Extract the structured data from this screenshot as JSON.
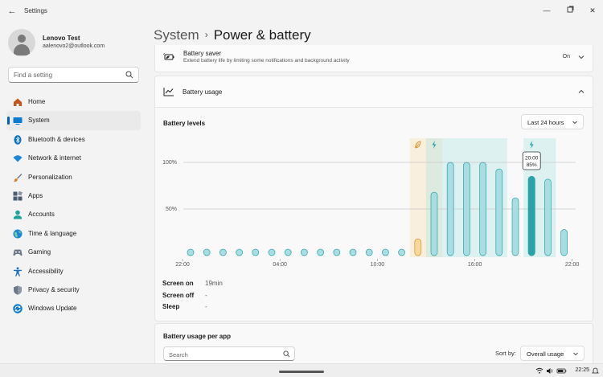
{
  "window": {
    "title": "Settings"
  },
  "profile": {
    "name": "Lenovo Test",
    "email": "aalenovo2@outlook.com"
  },
  "sidebar": {
    "search_placeholder": "Find a setting",
    "items": [
      {
        "label": "Home",
        "icon": "home-icon",
        "color": "#c7551e"
      },
      {
        "label": "System",
        "icon": "system-icon",
        "color": "#0a7bd0",
        "active": true
      },
      {
        "label": "Bluetooth & devices",
        "icon": "bluetooth-icon",
        "color": "#0a6fc7"
      },
      {
        "label": "Network & internet",
        "icon": "wifi-icon",
        "color": "#1b88d6"
      },
      {
        "label": "Personalization",
        "icon": "brush-icon",
        "color": "#d9822b"
      },
      {
        "label": "Apps",
        "icon": "apps-icon",
        "color": "#4b5b72"
      },
      {
        "label": "Accounts",
        "icon": "accounts-icon",
        "color": "#1aa39a"
      },
      {
        "label": "Time & language",
        "icon": "globe-icon",
        "color": "#1b88d6"
      },
      {
        "label": "Gaming",
        "icon": "gaming-icon",
        "color": "#6c7788"
      },
      {
        "label": "Accessibility",
        "icon": "accessibility-icon",
        "color": "#1b6fc2"
      },
      {
        "label": "Privacy & security",
        "icon": "shield-icon",
        "color": "#6c7788"
      },
      {
        "label": "Windows Update",
        "icon": "update-icon",
        "color": "#0a7bd0"
      }
    ]
  },
  "header": {
    "crumb_parent": "System",
    "crumb_separator": "›",
    "title": "Power & battery"
  },
  "battery_saver": {
    "title": "Battery saver",
    "description": "Extend battery life by limiting some notifications and background activity",
    "value": "On"
  },
  "battery_usage": {
    "title": "Battery usage",
    "levels_label": "Battery levels",
    "range": "Last 24 hours",
    "tooltip": {
      "time": "20:00",
      "level": "85%"
    },
    "stats": [
      {
        "label": "Screen on",
        "value": "19min"
      },
      {
        "label": "Screen off",
        "value": "-"
      },
      {
        "label": "Sleep",
        "value": "-"
      }
    ]
  },
  "chart_data": {
    "type": "bar",
    "ylim": [
      0,
      100
    ],
    "y_ticks": [
      "100%",
      "50%"
    ],
    "x_ticks": [
      "22:00",
      "04:00",
      "10:00",
      "16:00",
      "22:00"
    ],
    "values": [
      0,
      0,
      0,
      0,
      0,
      0,
      0,
      0,
      0,
      0,
      0,
      0,
      0,
      0,
      18,
      68,
      100,
      100,
      100,
      93,
      62,
      85,
      82,
      28
    ],
    "saver_band": [
      14,
      15
    ],
    "charge_band": [
      15,
      19
    ],
    "charge_band_2": [
      21,
      22
    ],
    "icons": [
      {
        "slot": 14,
        "icon": "battery-saver-leaf-icon",
        "color": "#d9922b"
      },
      {
        "slot": 15,
        "icon": "charging-bolt-icon",
        "color": "#2aa3a8"
      },
      {
        "slot": 21,
        "icon": "charging-bolt-icon",
        "color": "#2aa3a8"
      }
    ],
    "colors": {
      "bar": "#a8dde2",
      "bar_stroke": "#2aa3a8",
      "saver_bar": "#f7d79c",
      "saver_stroke": "#d9922b",
      "selected": "#2aa3a8"
    },
    "selected_slot": 21
  },
  "per_app": {
    "title": "Battery usage per app",
    "search_placeholder": "Search",
    "sort_label": "Sort by:",
    "sort_value": "Overall usage"
  },
  "taskbar": {
    "time": "22:25"
  }
}
